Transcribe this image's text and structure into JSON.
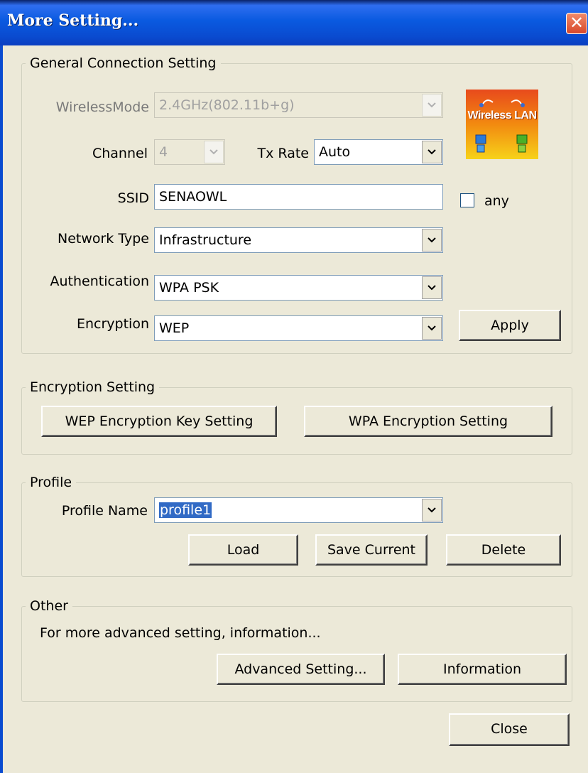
{
  "window": {
    "title": "More Setting...",
    "close_glyph": "✕"
  },
  "general": {
    "legend": "General Connection Setting",
    "wireless_mode": {
      "label": "WirelessMode",
      "value": "2.4GHz(802.11b+g)",
      "disabled": true
    },
    "channel": {
      "label": "Channel",
      "value": "4",
      "disabled": true
    },
    "tx_rate": {
      "label": "Tx Rate",
      "value": "Auto"
    },
    "ssid": {
      "label": "SSID",
      "value": "SENAOWL"
    },
    "any": {
      "label": "any",
      "checked": false
    },
    "network_type": {
      "label": "Network Type",
      "value": "Infrastructure"
    },
    "authentication": {
      "label": "Authentication",
      "value": "WPA PSK"
    },
    "encryption": {
      "label": "Encryption",
      "value": "WEP"
    },
    "apply_label": "Apply",
    "logo": {
      "text": "Wireless LAN",
      "icon": "wireless-lan-logo"
    }
  },
  "encryption_setting": {
    "legend": "Encryption Setting",
    "wep_button": "WEP Encryption Key Setting",
    "wpa_button": "WPA Encryption Setting"
  },
  "profile": {
    "legend": "Profile",
    "name_label": "Profile Name",
    "name_value": "profile1",
    "load_label": "Load",
    "save_label": "Save Current",
    "delete_label": "Delete"
  },
  "other": {
    "legend": "Other",
    "description": "For more advanced setting, information...",
    "advanced_label": "Advanced Setting...",
    "information_label": "Information"
  },
  "close_label": "Close",
  "colors": {
    "title_bar": "#0a4bd0",
    "face": "#ece9d8",
    "close_button": "#d8482a",
    "selection": "#316ac5"
  }
}
